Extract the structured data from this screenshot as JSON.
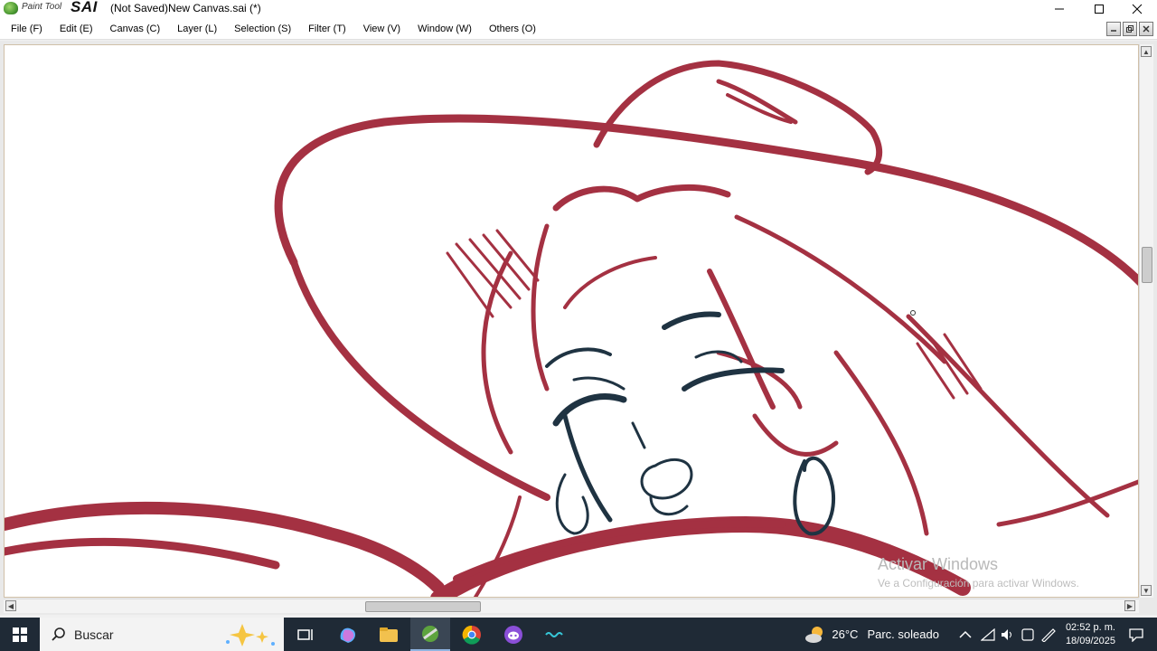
{
  "app": {
    "logo_small": "Paint Tool",
    "logo_big": "SAI",
    "window_title": "(Not Saved)New Canvas.sai (*)"
  },
  "menu": [
    {
      "label": "File (F)"
    },
    {
      "label": "Edit (E)"
    },
    {
      "label": "Canvas (C)"
    },
    {
      "label": "Layer (L)"
    },
    {
      "label": "Selection (S)"
    },
    {
      "label": "Filter (T)"
    },
    {
      "label": "View (V)"
    },
    {
      "label": "Window (W)"
    },
    {
      "label": "Others (O)"
    }
  ],
  "canvas": {
    "stroke_color": "#9b1b2e",
    "ink_color": "#1f3342",
    "watermark_title": "Activar Windows",
    "watermark_sub": "Ve a Configuración para activar Windows."
  },
  "taskbar": {
    "search_placeholder": "Buscar",
    "weather_temp": "26°C",
    "weather_desc": "Parc. soleado",
    "time": "02:52 p. m.",
    "date": "18/09/2025"
  }
}
